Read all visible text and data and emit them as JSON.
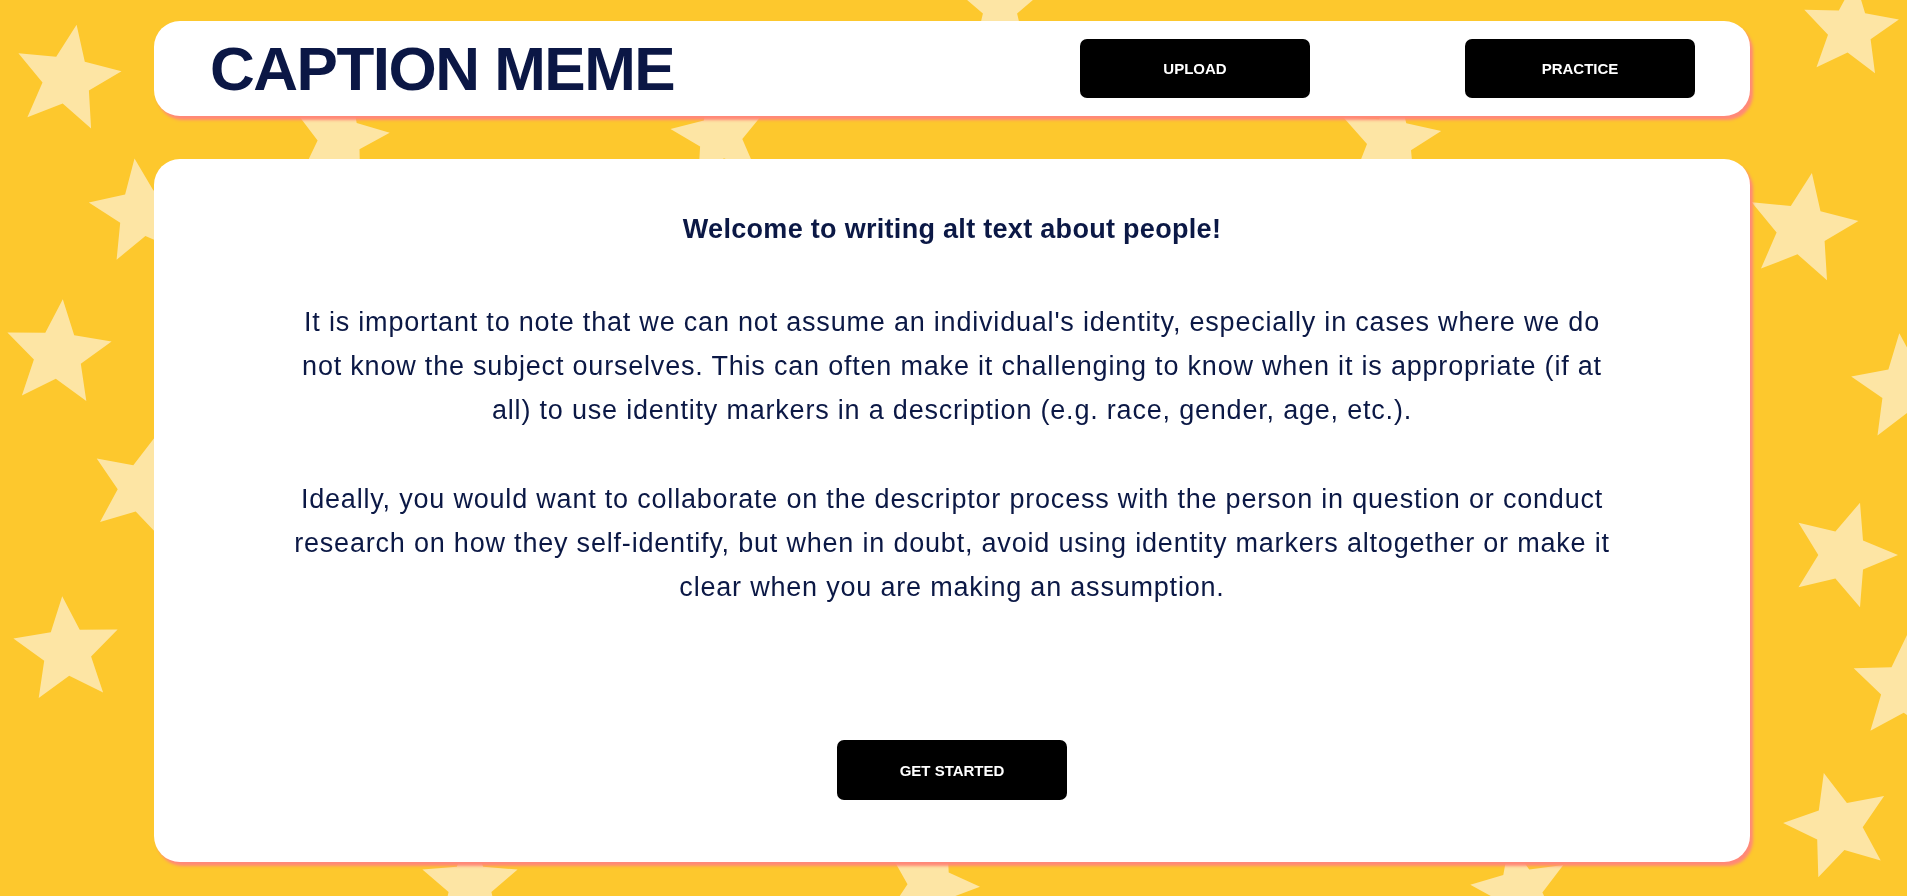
{
  "header": {
    "logo": "CAPTION MEME",
    "buttons": [
      {
        "label": "UPLOAD"
      },
      {
        "label": "PRACTICE"
      }
    ]
  },
  "intro": {
    "heading": "Welcome to writing alt text about people!",
    "paragraphs": [
      "It is important to note that we can not assume an individual's identity, especially in cases where we do not know the subject ourselves. This can often make it challenging to know when it is appropriate (if at all) to use identity markers in a description (e.g. race, gender, age, etc.).",
      "Ideally, you would want to collaborate on the descriptor process with the person in question or conduct research on how they self-identify, but when in doubt, avoid using identity markers altogether or make it clear when you are making an assumption."
    ],
    "button": "GET STARTED"
  }
}
